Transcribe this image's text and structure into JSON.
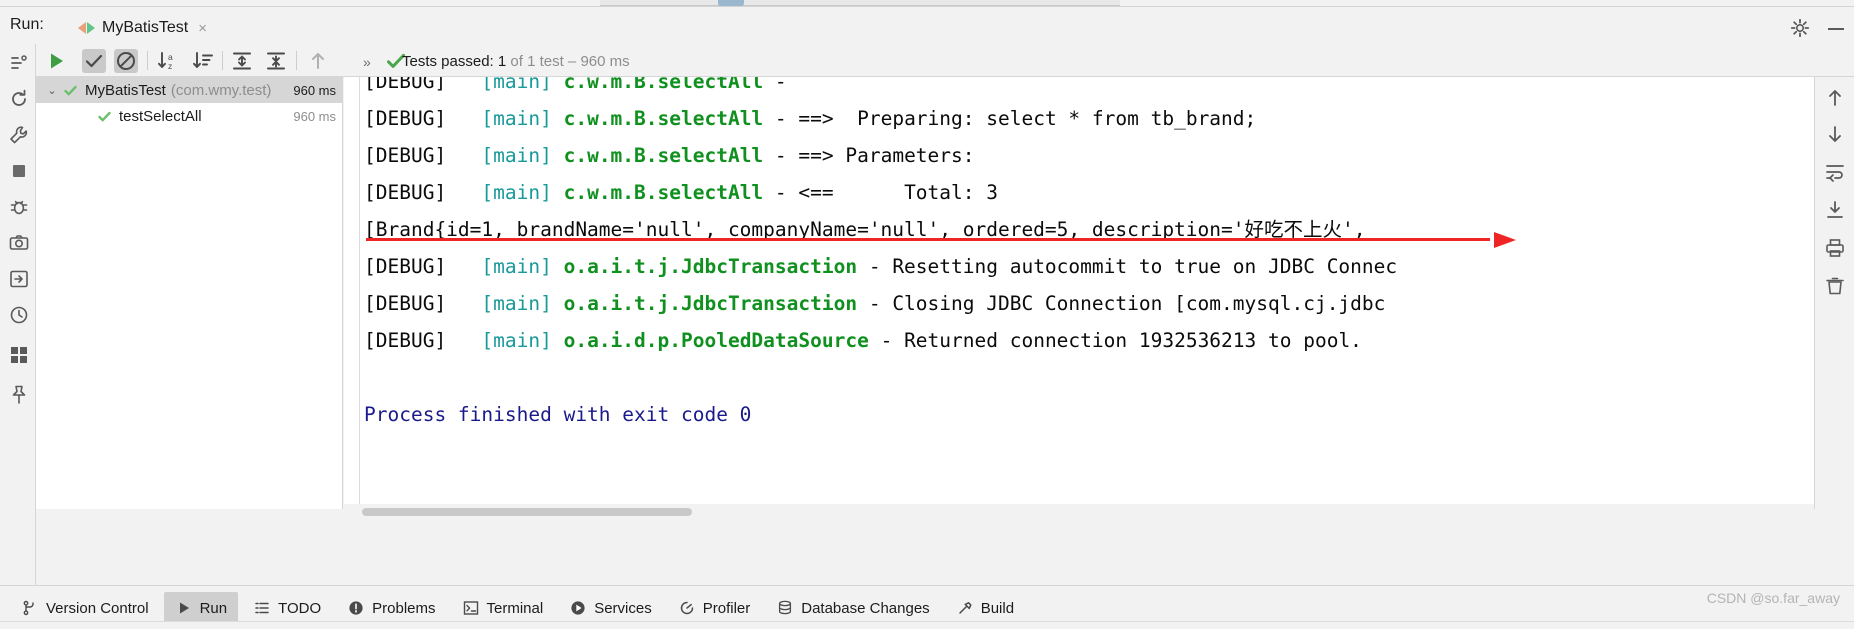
{
  "window": {
    "run_label": "Run:",
    "tab_title": "MyBatisTest",
    "tab_close": "×",
    "runcfg_icon": "run-configuration-icon",
    "gear_icon": "gear-icon",
    "minimize_icon": "minimize-icon"
  },
  "toolbar": {
    "rerun_icon": "run-icon",
    "show_passed_icon": "check-icon",
    "hide_ignored_icon": "no-entry-icon",
    "sort_alpha_icon": "sort-alphabetically-icon",
    "sort_duration_icon": "sort-by-duration-icon",
    "expand_all_icon": "expand-all-icon",
    "collapse_all_icon": "collapse-all-icon",
    "prev_failed_icon": "arrow-up-icon",
    "more_icon": "chevron-double-right-icon",
    "more_label": "»",
    "status_check_icon": "green-check-icon",
    "status_main": "Tests passed: 1",
    "status_dim": " of 1 test – 960 ms"
  },
  "tree": {
    "rows": [
      {
        "arrow": "⌄",
        "check_icon": "green-check-icon",
        "label": "MyBatisTest",
        "package": "(com.wmy.test)",
        "time": "960 ms",
        "selected": true,
        "indent": false
      },
      {
        "arrow": "",
        "check_icon": "green-check-icon",
        "label": "testSelectAll",
        "package": "",
        "time": "960 ms",
        "selected": false,
        "indent": true
      }
    ]
  },
  "console": {
    "lines": [
      {
        "segments": [
          {
            "text": "[DEBUG]   ",
            "color": "black"
          },
          {
            "text": "[main] ",
            "color": "teal"
          },
          {
            "text": "c.w.m.B.selectAll",
            "color": "green"
          },
          {
            "text": " - ",
            "color": "black"
          }
        ],
        "partial_top": true
      },
      {
        "segments": [
          {
            "text": "[DEBUG]   ",
            "color": "black"
          },
          {
            "text": "[main] ",
            "color": "teal"
          },
          {
            "text": "c.w.m.B.selectAll",
            "color": "green"
          },
          {
            "text": " - ==>  Preparing: select * from tb_brand;",
            "color": "black"
          }
        ]
      },
      {
        "segments": [
          {
            "text": "[DEBUG]   ",
            "color": "black"
          },
          {
            "text": "[main] ",
            "color": "teal"
          },
          {
            "text": "c.w.m.B.selectAll",
            "color": "green"
          },
          {
            "text": " - ==> Parameters: ",
            "color": "black"
          }
        ]
      },
      {
        "segments": [
          {
            "text": "[DEBUG]   ",
            "color": "black"
          },
          {
            "text": "[main] ",
            "color": "teal"
          },
          {
            "text": "c.w.m.B.selectAll",
            "color": "green"
          },
          {
            "text": " - <==      Total: 3",
            "color": "black"
          }
        ]
      },
      {
        "segments": [
          {
            "text": "[Brand{id=1, brandName='null', companyName='null', ordered=5, description='好吃不上火',",
            "color": "black"
          }
        ]
      },
      {
        "segments": [
          {
            "text": "[DEBUG]   ",
            "color": "black"
          },
          {
            "text": "[main] ",
            "color": "teal"
          },
          {
            "text": "o.a.i.t.j.JdbcTransaction",
            "color": "green"
          },
          {
            "text": " - Resetting autocommit to true on JDBC Connec",
            "color": "black"
          }
        ]
      },
      {
        "segments": [
          {
            "text": "[DEBUG]   ",
            "color": "black"
          },
          {
            "text": "[main] ",
            "color": "teal"
          },
          {
            "text": "o.a.i.t.j.JdbcTransaction",
            "color": "green"
          },
          {
            "text": " - Closing JDBC Connection [com.mysql.cj.jdbc",
            "color": "black"
          }
        ]
      },
      {
        "segments": [
          {
            "text": "[DEBUG]   ",
            "color": "black"
          },
          {
            "text": "[main] ",
            "color": "teal"
          },
          {
            "text": "o.a.i.d.p.PooledDataSource",
            "color": "green"
          },
          {
            "text": " - Returned connection 1932536213 to pool.",
            "color": "black"
          }
        ]
      },
      {
        "segments": [
          {
            "text": " ",
            "color": "black"
          }
        ]
      },
      {
        "segments": [
          {
            "text": "Process finished with exit code 0",
            "color": "blue"
          }
        ]
      }
    ]
  },
  "annotation": {
    "name": "red-arrow-annotation",
    "color": "#ef2424"
  },
  "right_gutter": {
    "icons": [
      "arrow-up-icon",
      "arrow-down-icon",
      "soft-wrap-icon",
      "scroll-to-end-icon",
      "print-icon",
      "clear-all-icon"
    ]
  },
  "left_gutter": {
    "icons": [
      "structure-icon",
      "restart-icon",
      "settings-wrench-icon",
      "stop-icon",
      "debug-bug-icon",
      "camera-icon",
      "export-icon",
      "history-icon",
      "grid-icon",
      "pin-icon"
    ]
  },
  "bottom_bar": {
    "items": [
      {
        "label": "Version Control",
        "icon": "branch-icon",
        "active": false
      },
      {
        "label": "Run",
        "icon": "run-triangle-icon",
        "active": true
      },
      {
        "label": "TODO",
        "icon": "todo-list-icon",
        "active": false
      },
      {
        "label": "Problems",
        "icon": "problems-icon",
        "active": false
      },
      {
        "label": "Terminal",
        "icon": "terminal-icon",
        "active": false
      },
      {
        "label": "Services",
        "icon": "services-icon",
        "active": false
      },
      {
        "label": "Profiler",
        "icon": "profiler-icon",
        "active": false
      },
      {
        "label": "Database Changes",
        "icon": "database-changes-icon",
        "active": false
      },
      {
        "label": "Build",
        "icon": "build-hammer-icon",
        "active": false
      }
    ],
    "watermark": "CSDN @so.far_away"
  }
}
